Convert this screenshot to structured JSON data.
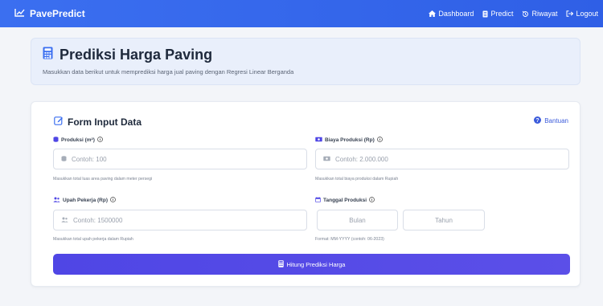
{
  "navbar": {
    "brand": "PavePredict",
    "links": [
      {
        "label": "Dashboard",
        "icon": "home-icon"
      },
      {
        "label": "Predict",
        "icon": "document-icon"
      },
      {
        "label": "Riwayat",
        "icon": "history-icon"
      },
      {
        "label": "Logout",
        "icon": "logout-icon"
      }
    ]
  },
  "header": {
    "title": "Prediksi Harga Paving",
    "subtitle": "Masukkan data berikut untuk memprediksi harga jual paving dengan Regresi Linear Berganda"
  },
  "form": {
    "title": "Form Input Data",
    "help_label": "Bantuan",
    "produksi": {
      "label": "Produksi (m²)",
      "placeholder": "Contoh: 100",
      "help": "Masukkan total luas area paving dalam meter persegi"
    },
    "biaya": {
      "label": "Biaya Produksi (Rp)",
      "placeholder": "Contoh: 2.000.000",
      "help": "Masukkan total biaya produksi dalam Rupiah"
    },
    "upah": {
      "label": "Upah Pekerja (Rp)",
      "placeholder": "Contoh: 1500000",
      "help": "Masukkan total upah pekerja dalam Rupiah"
    },
    "tanggal": {
      "label": "Tanggal Produksi",
      "bulan_placeholder": "Bulan",
      "tahun_placeholder": "Tahun",
      "help": "Format: MM-YYYY (contoh: 06-2023)"
    },
    "submit_label": "Hitung Prediksi Harga"
  },
  "colors": {
    "navbar": "#2f5fe6",
    "accent": "#4f46e5",
    "header_bg": "#e9effb",
    "page_bg": "#f3f5f9"
  }
}
